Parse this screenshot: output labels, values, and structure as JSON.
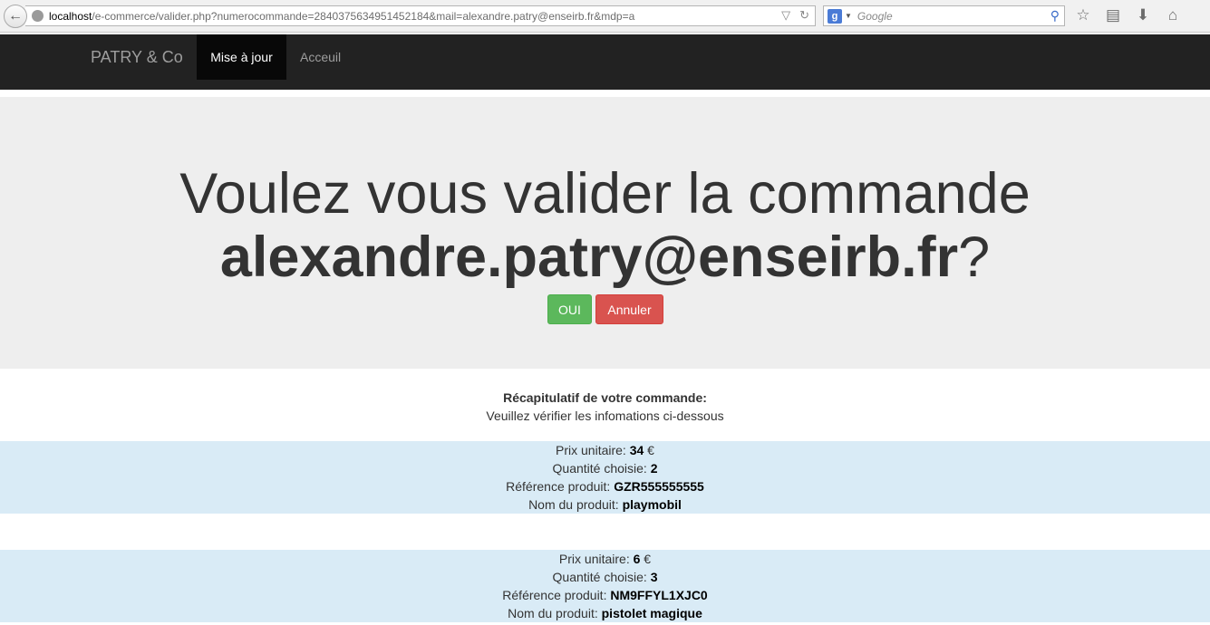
{
  "browser": {
    "url_host": "localhost",
    "url_rest": "/e-commerce/valider.php?numerocommande=2840375634951452184&mail=alexandre.patry@enseirb.fr&mdp=a",
    "search_placeholder": "Google",
    "search_engine_icon": "g"
  },
  "navbar": {
    "brand": "PATRY & Co",
    "items": [
      {
        "label": "Mise à jour",
        "active": true
      },
      {
        "label": "Acceuil",
        "active": false
      }
    ]
  },
  "jumbotron": {
    "line1": "Voulez vous valider la commande",
    "email": "alexandre.patry@enseirb.fr",
    "suffix": "?",
    "confirm_label": "OUI",
    "cancel_label": "Annuler"
  },
  "summary": {
    "title": "Récapitulatif de votre commande:",
    "subtitle": "Veuillez vérifier les infomations ci-dessous"
  },
  "labels": {
    "price": "Prix unitaire: ",
    "currency": " €",
    "quantity": "Quantité choisie: ",
    "reference": "Référence produit: ",
    "name": "Nom du produit: "
  },
  "products": [
    {
      "price": "34",
      "quantity": "2",
      "reference": "GZR555555555",
      "name": "playmobil"
    },
    {
      "price": "6",
      "quantity": "3",
      "reference": "NM9FFYL1XJC0",
      "name": "pistolet magique"
    }
  ],
  "colors": {
    "navbar_bg": "#222222",
    "nav_active_bg": "#080808",
    "jumbotron_bg": "#eeeeee",
    "confirm": "#5cb85c",
    "cancel": "#d9534f",
    "product_row_bg": "#d9ebf6"
  }
}
